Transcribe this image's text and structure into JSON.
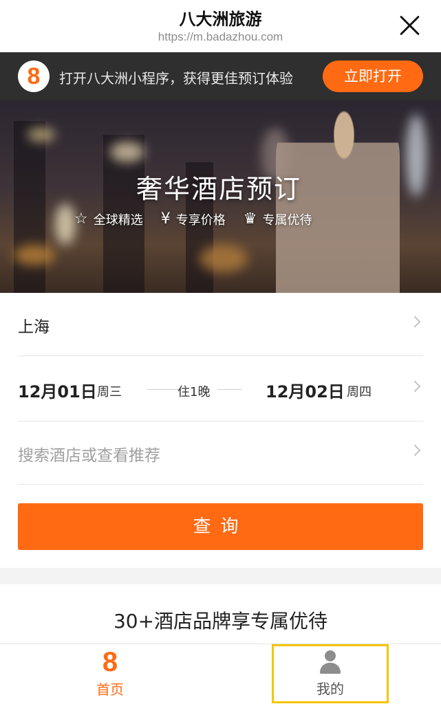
{
  "header": {
    "title": "八大洲旅游",
    "url": "https://m.badazhou.com"
  },
  "promo": {
    "logo_text": "8",
    "text": "打开八大洲小程序，获得更佳预订体验",
    "button_label": "立即打开",
    "accent_color": "#ff6a13"
  },
  "banner": {
    "headline": "奢华酒店预订",
    "features": [
      {
        "icon": "star-outline-icon",
        "glyph": "☆",
        "label": "全球精选"
      },
      {
        "icon": "yen-icon",
        "glyph": "¥",
        "label": "专享价格"
      },
      {
        "icon": "crown-icon",
        "glyph": "♛",
        "label": "专属优待"
      }
    ]
  },
  "form": {
    "city": "上海",
    "checkin_date": "12月01日",
    "checkin_weekday": "周三",
    "nights": "住1晚",
    "checkout_date": "12月02日",
    "checkout_weekday": "周四",
    "search_placeholder": "搜索酒店或查看推荐",
    "query_button": "查询"
  },
  "section": {
    "brands_title": "30+酒店品牌享专属优待"
  },
  "tabbar": {
    "home_icon": "8",
    "home_label": "首页",
    "mine_label": "我的",
    "active_color": "#ff6a13",
    "highlight_color": "#f5c400"
  }
}
